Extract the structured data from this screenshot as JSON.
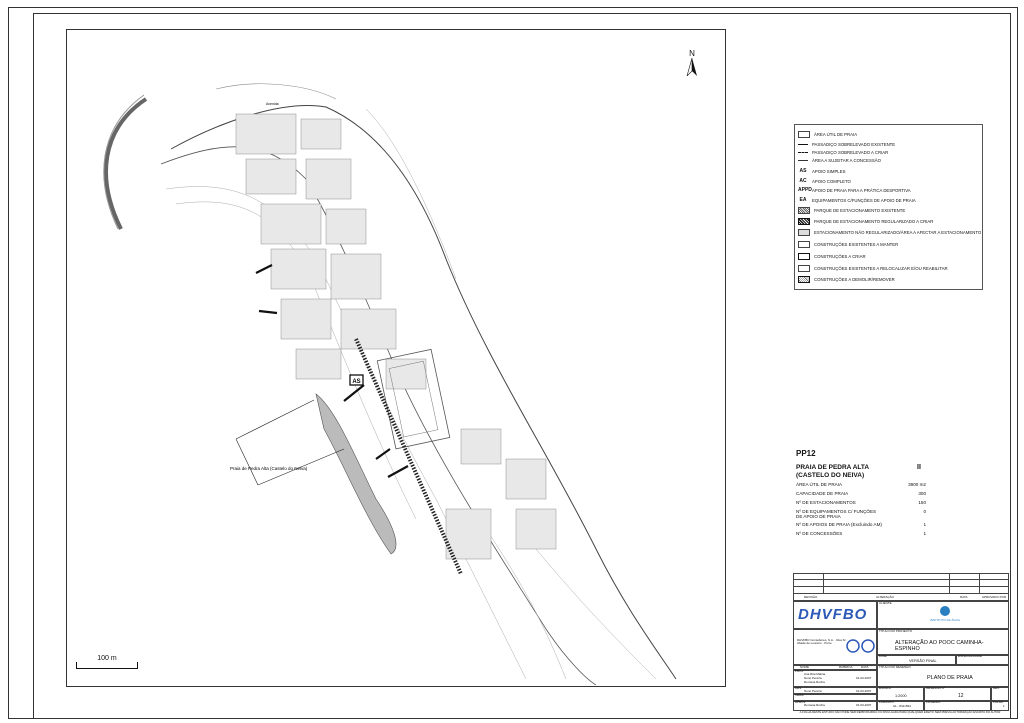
{
  "north_label": "N",
  "legend": {
    "items": [
      {
        "symbol": "",
        "type": "box",
        "label": "ÁREA ÚTIL DE PRAIA"
      },
      {
        "symbol": "",
        "type": "line-thick",
        "label": "PASSADIÇO SOBRELEVADO EXISTENTE"
      },
      {
        "symbol": "",
        "type": "line-dash",
        "label": "PASSADIÇO SOBRELEVADO A CRIAR"
      },
      {
        "symbol": "",
        "type": "line-thin",
        "label": "ÁREA A SUJEITAR A CONCESSÃO"
      },
      {
        "symbol": "AS",
        "type": "text",
        "label": "APOIO SIMPLES"
      },
      {
        "symbol": "AC",
        "type": "text",
        "label": "APOIO COMPLETO"
      },
      {
        "symbol": "APPD",
        "type": "text",
        "label": "APOIO DE PRAIA PARA A PRÁTICA DESPORTIVA"
      },
      {
        "symbol": "EA",
        "type": "text",
        "label": "EQUIPAMENTOS C/FUNÇÕES DE APOIO DE PRAIA"
      },
      {
        "symbol": "",
        "type": "hatch",
        "label": "PARQUE DE ESTACIONAMENTO EXISTENTE"
      },
      {
        "symbol": "",
        "type": "hatch-bold",
        "label": "PARQUE DE ESTACIONAMENTO REGULARIZADO A CRIAR"
      },
      {
        "symbol": "",
        "type": "box-grey",
        "label": "ESTACIONAMENTO NÃO REGULARIZADO/ÁREA A AFECTAR A ESTACIONAMENTO"
      },
      {
        "symbol": "",
        "type": "box",
        "label": "CONSTRUÇÕES EXISTENTES A MANTER"
      },
      {
        "symbol": "",
        "type": "box-bold",
        "label": "CONSTRUÇÕES A CRIAR"
      },
      {
        "symbol": "",
        "type": "box",
        "label": "CONSTRUÇÕES EXISTENTES A RELOCALIZAR E/OU REABILITAR"
      },
      {
        "symbol": "",
        "type": "box-cross",
        "label": "CONSTRUÇÕES A DEMOLIR/REMOVER"
      }
    ]
  },
  "beach": {
    "code": "PP12",
    "name_line1": "PRAIA DE PEDRA ALTA",
    "name_line2": "(CASTELO DO NEIVA)",
    "class": "II",
    "stats": [
      {
        "label": "ÁREA ÚTIL DE PRAIA",
        "value": "3900 m2"
      },
      {
        "label": "CAPACIDADE DE PRAIA",
        "value": "300"
      },
      {
        "label": "Nº DE ESTACIONAMENTOS",
        "value": "150"
      },
      {
        "label": "Nº DE EQUIPAMENTOS C/ FUNÇÕES",
        "label2": "DE APOIO DE PRAIA",
        "value": "0"
      },
      {
        "label": "Nº DE APOIOS DE PRAIA (Excluindo AM)",
        "value": "1"
      },
      {
        "label": "Nº DE CONCESSÕES",
        "value": "1"
      }
    ]
  },
  "map": {
    "beach_label": "Praia de Pedra Alta (Castelo do Neiva)",
    "support_tag": "AS",
    "road_label": "Avenida"
  },
  "scale_bar": {
    "label": "100 m"
  },
  "title_block": {
    "rev_headers": [
      "REVISÃO",
      "ALTERAÇÃO",
      "DATA",
      "APROVADO POR"
    ],
    "company_logo": "DHVFBO",
    "client_label": "CLIENTE",
    "client_logo_text": "INSTITUTO DA ÁGUA",
    "project_label": "TÍTULO DO PROJECTO",
    "project_title": "ALTERAÇÃO AO POOC CAMINHA-ESPINHO",
    "company_info": "DHVFBO Consultores, S.A. · Rua Sr. Abade de Loureiro · Porto",
    "fase_label": "FASE",
    "fase": "VERSÃO FINAL",
    "esp_label": "ESPECIALIDADE",
    "drawing_title_label": "TÍTULO DO DESENHO",
    "drawing_title": "PLANO DE PRAIA",
    "roles": [
      {
        "role": "PROJ.",
        "name": "Ana Rita Malina",
        "name2": "Nuno Pereira",
        "name3": "Romana Rocha",
        "date": "01-03-2007"
      },
      {
        "role": "DES.",
        "name": "Nuno Pereira",
        "date": "01-03-2007"
      },
      {
        "role": "VERIF.",
        "name": "",
        "date": ""
      },
      {
        "role": "APROV.",
        "name": "Romana Rocha",
        "date": "01-03-2007"
      }
    ],
    "nome_label": "NOME",
    "rubrica_label": "RUBRICA",
    "data_label": "DATA",
    "escala_label": "ESCALA",
    "escala": "1:2000",
    "desenho_label": "DESENHO Nº",
    "desenho": "12",
    "rev_label": "REV.",
    "formato_label": "FORMATO",
    "formato": "A1 - 841x594",
    "ficheiro_label": "FICHEIRO",
    "folha_label": "FOLHA",
    "folha": "1",
    "footer_note": "A FOLHA DESTE ESTUDO NÃO PODE SER REPRODUZIDA OU DIVULGADA PARA QUALQUER EFEITO SEM PRÉVIA AUTORIZAÇÃO ESCRITA DO AUTOR"
  }
}
